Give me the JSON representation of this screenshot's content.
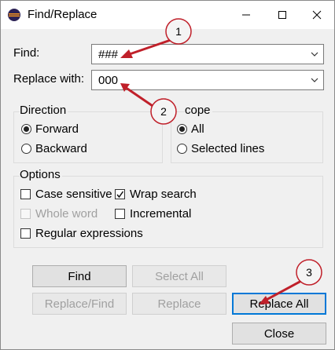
{
  "window": {
    "title": "Find/Replace"
  },
  "find": {
    "label": "Find:",
    "value": "###"
  },
  "replace": {
    "label": "Replace with:",
    "value": "000"
  },
  "direction": {
    "title": "Direction",
    "options": [
      {
        "label": "Forward",
        "selected": true
      },
      {
        "label": "Backward",
        "selected": false
      }
    ]
  },
  "scope": {
    "title": "Scope",
    "title_visible": "cope",
    "options": [
      {
        "label": "All",
        "selected": true
      },
      {
        "label": "Selected lines",
        "selected": false
      }
    ]
  },
  "options": {
    "title": "Options",
    "items": [
      {
        "label": "Case sensitive",
        "checked": false,
        "enabled": true
      },
      {
        "label": "Wrap search",
        "checked": true,
        "enabled": true
      },
      {
        "label": "Whole word",
        "checked": false,
        "enabled": false
      },
      {
        "label": "Incremental",
        "checked": false,
        "enabled": true
      },
      {
        "label": "Regular expressions",
        "checked": false,
        "enabled": true
      }
    ]
  },
  "buttons": {
    "find": "Find",
    "select_all": "Select All",
    "replace_find": "Replace/Find",
    "replace": "Replace",
    "replace_all": "Replace All",
    "close": "Close"
  },
  "annotations": [
    "1",
    "2",
    "3"
  ],
  "colors": {
    "annotation_fill": "#f4f4f4",
    "annotation_stroke": "#c0202a",
    "focus": "#0078d7"
  }
}
